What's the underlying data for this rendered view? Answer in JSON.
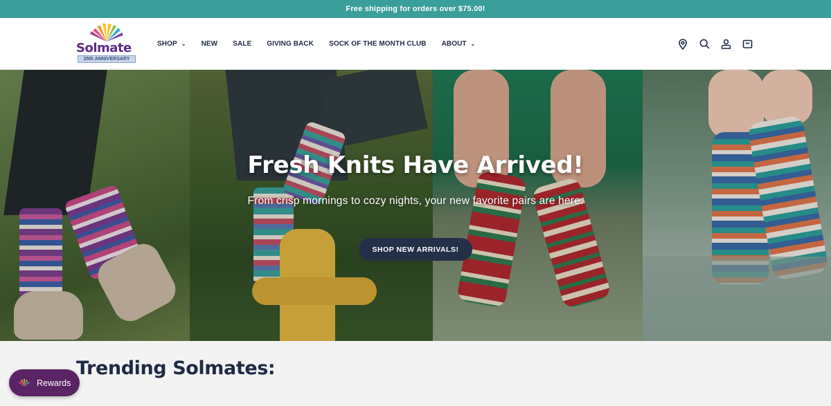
{
  "announcement": {
    "text": "Free shipping for orders over $75.00!"
  },
  "logo": {
    "brand": "Solmate",
    "badge": "25th ANNIVERSARY"
  },
  "nav": {
    "items": [
      {
        "label": "SHOP",
        "dropdown": true
      },
      {
        "label": "NEW",
        "dropdown": false
      },
      {
        "label": "SALE",
        "dropdown": false
      },
      {
        "label": "GIVING BACK",
        "dropdown": false
      },
      {
        "label": "SOCK OF THE MONTH CLUB",
        "dropdown": false
      },
      {
        "label": "ABOUT",
        "dropdown": true
      }
    ]
  },
  "header_icons": [
    "location-pin-icon",
    "search-icon",
    "account-icon",
    "cart-icon"
  ],
  "hero": {
    "title": "Fresh Knits Have Arrived!",
    "subtitle": "From crisp mornings to cozy nights, your new favorite pairs are here.",
    "button_label": "SHOP NEW ARRIVALS!"
  },
  "trending": {
    "heading": "Trending Solmates:"
  },
  "rewards": {
    "label": "Rewards",
    "icon": "sun-icon"
  },
  "colors": {
    "announcement_bg": "#3a9e9a",
    "brand_purple": "#5b2a86",
    "button_navy": "#243047",
    "rewards_bg": "#5a2363",
    "text_navy": "#1f2a44"
  }
}
